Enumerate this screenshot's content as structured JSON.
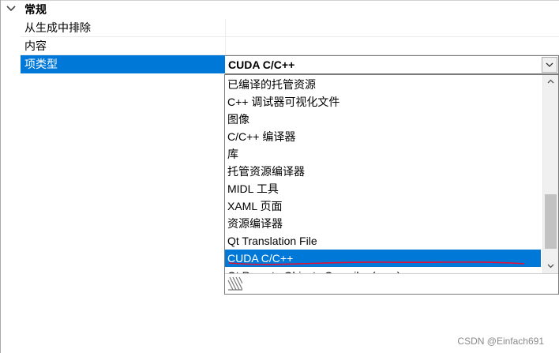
{
  "category": {
    "label": "常规"
  },
  "properties": [
    {
      "label": "从生成中排除",
      "value": ""
    },
    {
      "label": "内容",
      "value": ""
    },
    {
      "label": "项类型",
      "value": "CUDA C/C++"
    }
  ],
  "dropdown": {
    "options": [
      "已编译的托管资源",
      "C++ 调试器可视化文件",
      "图像",
      "C/C++ 编译器",
      "库",
      "托管资源编译器",
      "MIDL 工具",
      "XAML 页面",
      "资源编译器",
      "Qt Translation File",
      "CUDA C/C++",
      "Qt Remote Objects Compiler (repc)"
    ],
    "selected_index": 10,
    "scroll_position": 0.7
  },
  "colors": {
    "selection": "#0078d7",
    "annotation": "#e0103a"
  },
  "watermark": "CSDN @Einfach691"
}
